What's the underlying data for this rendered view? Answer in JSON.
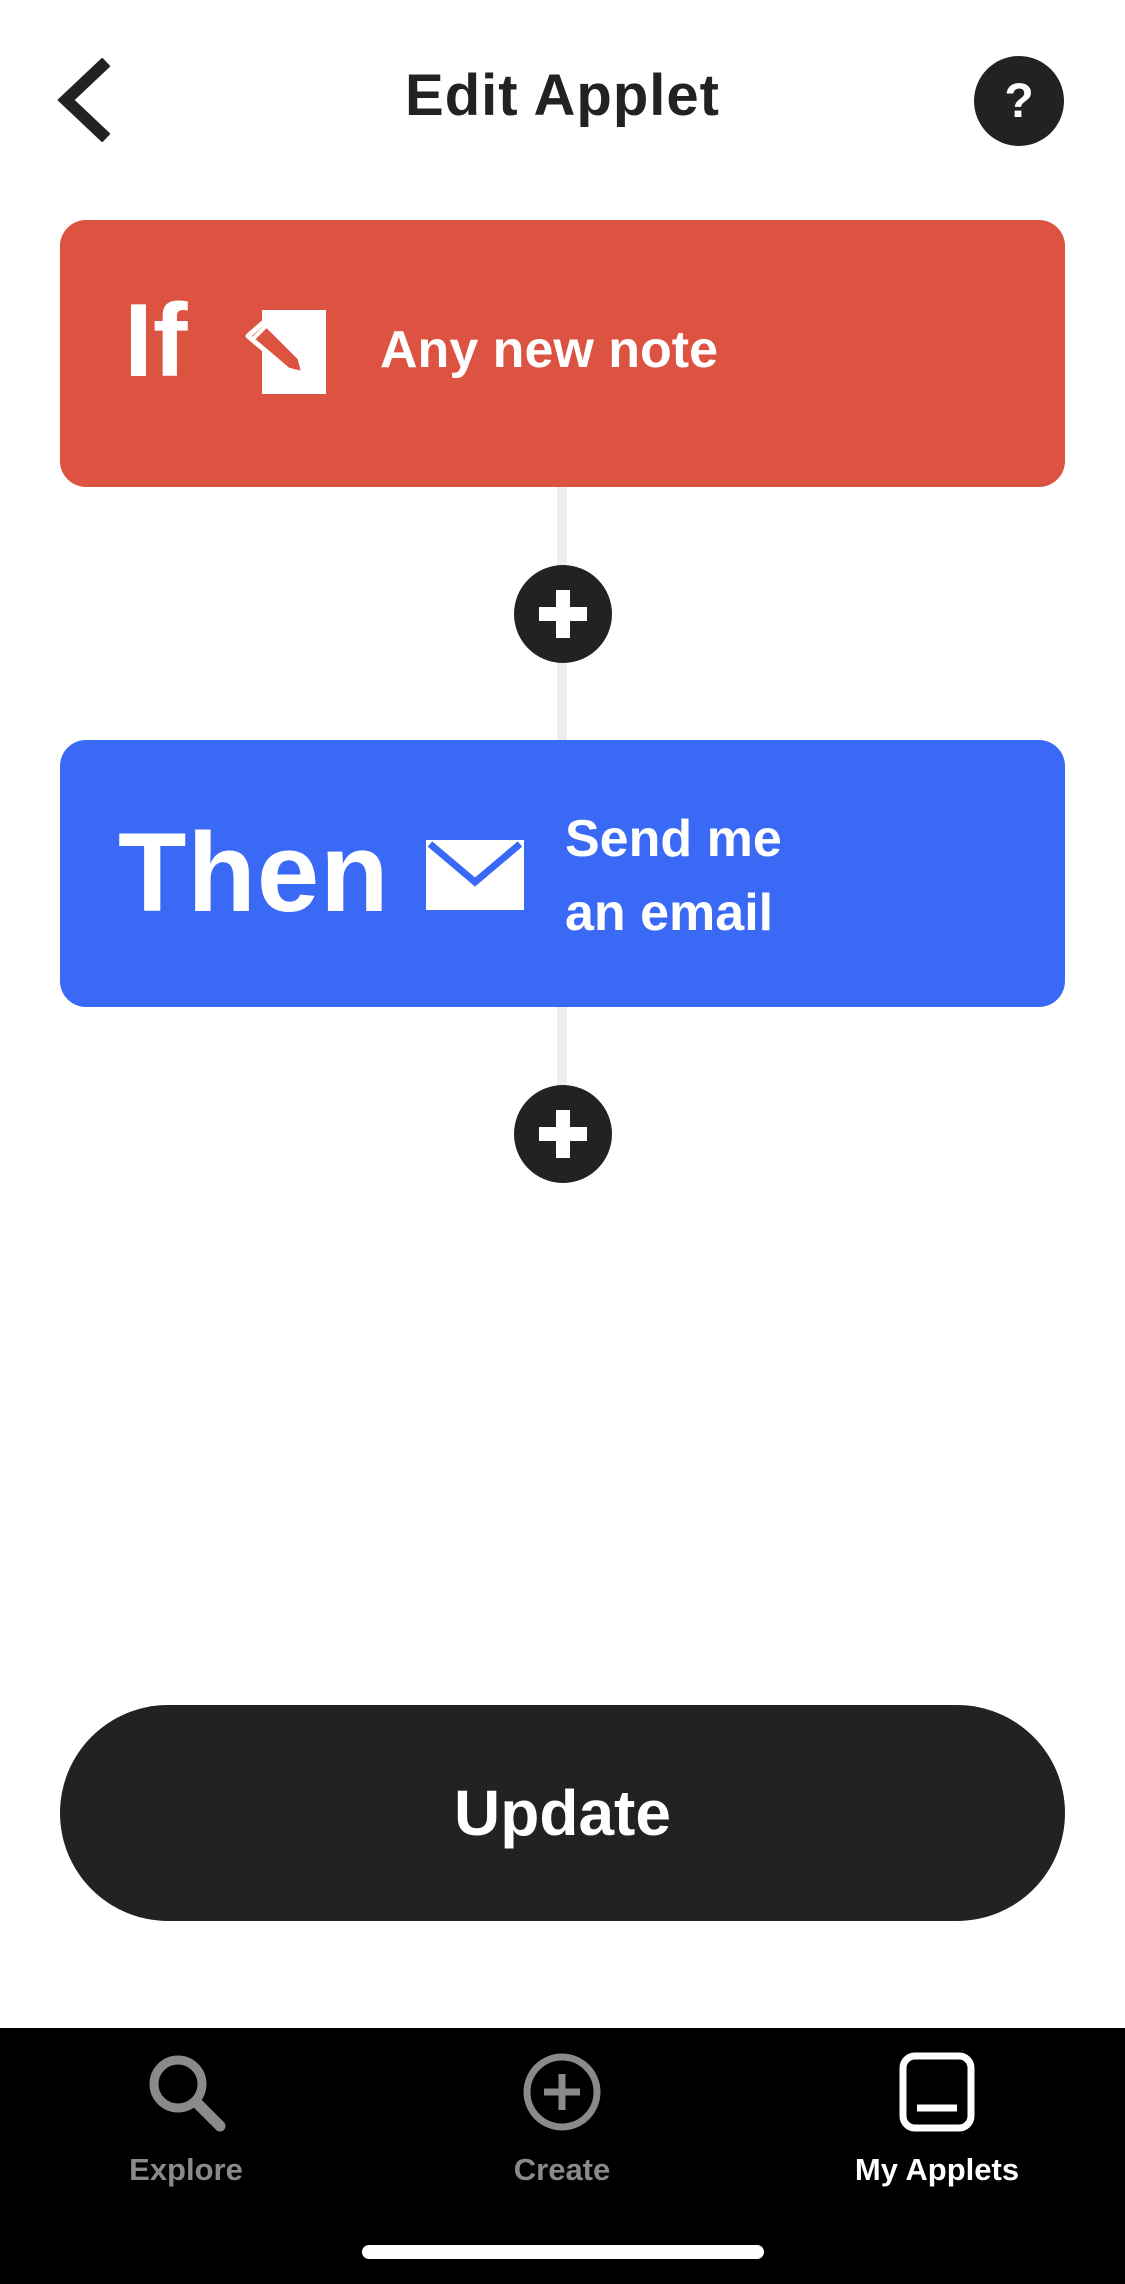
{
  "header": {
    "title": "Edit Applet",
    "help_label": "?"
  },
  "trigger": {
    "keyword": "If",
    "label": "Any new note",
    "icon": "note-pencil-icon",
    "color": "#DD5341"
  },
  "action": {
    "keyword": "Then",
    "label_line1": "Send me",
    "label_line2": "an email",
    "icon": "envelope-icon",
    "color": "#3A6AF5"
  },
  "update_button": {
    "label": "Update"
  },
  "tabbar": {
    "tabs": [
      {
        "label": "Explore",
        "icon": "search-icon",
        "active": false
      },
      {
        "label": "Create",
        "icon": "plus-circle-icon",
        "active": false
      },
      {
        "label": "My Applets",
        "icon": "applets-icon",
        "active": true
      }
    ]
  }
}
